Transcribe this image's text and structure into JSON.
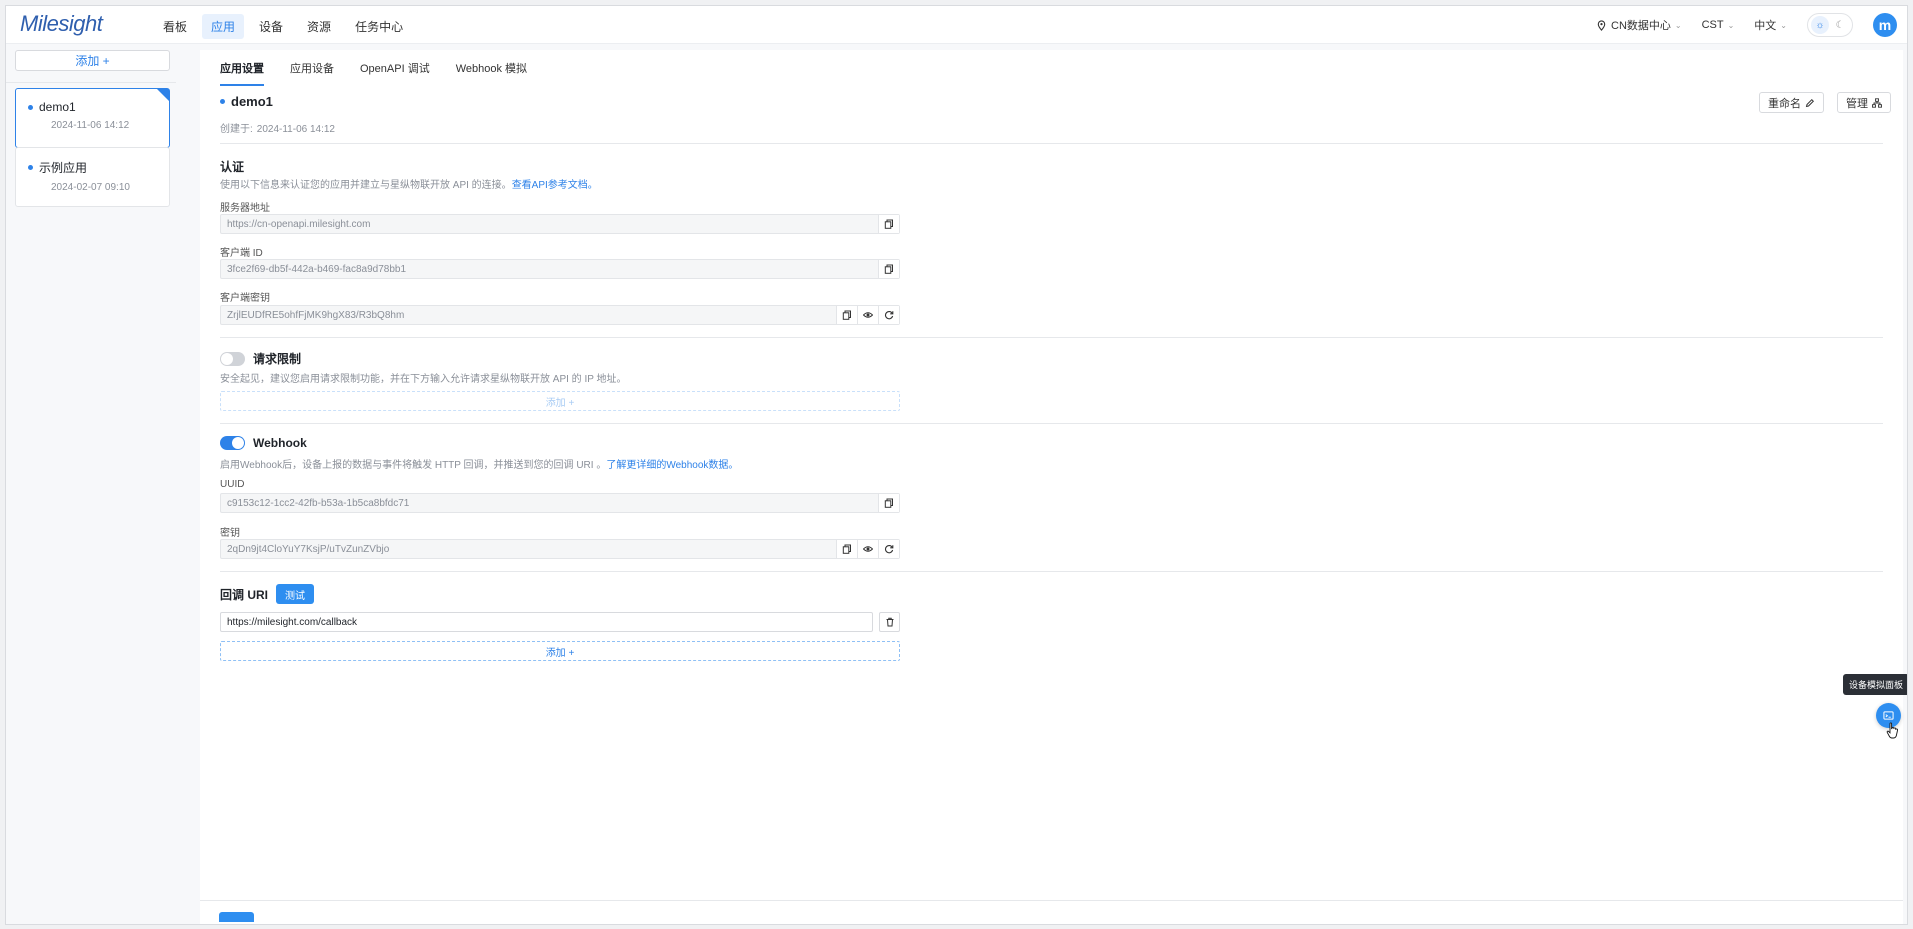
{
  "header": {
    "logo_text": "Milesight",
    "nav": [
      "看板",
      "应用",
      "设备",
      "资源",
      "任务中心"
    ],
    "active_nav": 1,
    "datacenter": "CN数据中心",
    "timezone": "CST",
    "language": "中文",
    "user_initial": "m"
  },
  "sidebar": {
    "add_label": "添加 +",
    "apps": [
      {
        "name": "demo1",
        "date": "2024-11-06 14:12",
        "selected": true
      },
      {
        "name": "示例应用",
        "date": "2024-02-07 09:10",
        "selected": false
      }
    ]
  },
  "tabs": [
    "应用设置",
    "应用设备",
    "OpenAPI 调试",
    "Webhook 模拟"
  ],
  "app": {
    "name": "demo1",
    "created_label": "创建于:",
    "created_at": "2024-11-06 14:12",
    "rename_label": "重命名",
    "manage_label": "管理"
  },
  "auth": {
    "title": "认证",
    "desc": "使用以下信息来认证您的应用并建立与星纵物联开放 API 的连接。",
    "desc_link": "查看API参考文档。",
    "server_label": "服务器地址",
    "server_value": "https://cn-openapi.milesight.com",
    "client_id_label": "客户端 ID",
    "client_id_value": "3fce2f69-db5f-442a-b469-fac8a9d78bb1",
    "client_secret_label": "客户端密钥",
    "client_secret_value": "ZrjlEUDfRE5ohfFjMK9hgX83/R3bQ8hm"
  },
  "rate_limit": {
    "title": "请求限制",
    "enabled": false,
    "desc": "安全起见，建议您启用请求限制功能，并在下方输入允许请求星纵物联开放 API 的 IP 地址。",
    "add_label": "添加 +"
  },
  "webhook": {
    "title": "Webhook",
    "enabled": true,
    "desc": "启用Webhook后，设备上报的数据与事件将触发 HTTP 回调，并推送到您的回调 URI 。",
    "desc_link": "了解更详细的Webhook数据。",
    "uuid_label": "UUID",
    "uuid_value": "c9153c12-1cc2-42fb-b53a-1b5ca8bfdc71",
    "secret_label": "密钥",
    "secret_value": "2qDn9jt4CloYuY7KsjP/uTvZunZVbjo"
  },
  "callback": {
    "title": "回调 URI",
    "test_label": "测试",
    "uri_value": "https://milesight.com/callback",
    "add_label": "添加 +"
  },
  "floating": {
    "tooltip": "设备模拟面板"
  },
  "colors": {
    "accent": "#2e82e8",
    "primary_button": "#2e8ef0"
  }
}
